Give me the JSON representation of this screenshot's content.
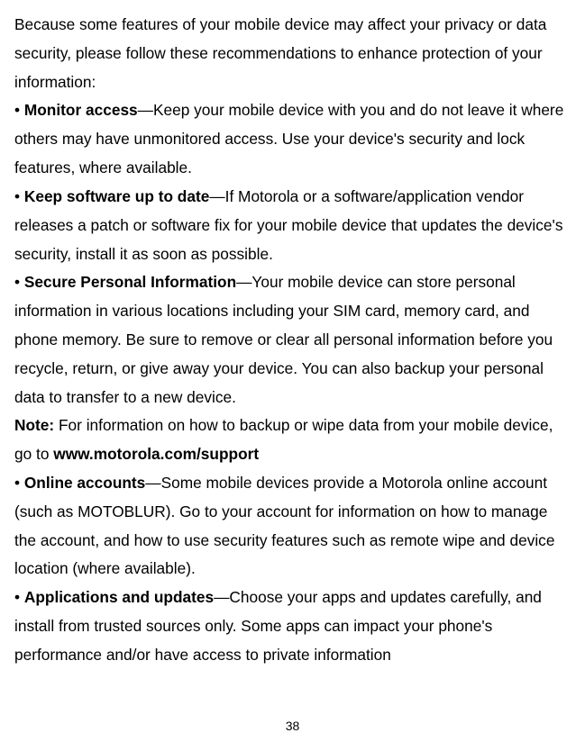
{
  "intro": "Because some features of your mobile device may affect your privacy or data security, please follow these recommendations to enhance protection of your information:",
  "items": [
    {
      "title": "Monitor access",
      "body": "—Keep your mobile device with you and do not leave it where others may have unmonitored access. Use your device's security and lock features, where available."
    },
    {
      "title": "Keep software up to date",
      "body": "—If Motorola or a software/application vendor releases a patch or software fix for your mobile device that updates the device's security, install it as soon as possible."
    },
    {
      "title": "Secure Personal Information",
      "body": "—Your mobile device can store personal information in various locations including your SIM card, memory card, and phone memory. Be sure to remove or clear all personal information before you recycle, return, or give away your device. You can also backup your personal data to transfer to a new device."
    }
  ],
  "note_label": "Note:",
  "note_body_pre": " For information on how to backup or wipe data from your mobile device, go to ",
  "note_url": "www.motorola.com/support",
  "items2": [
    {
      "title": "Online accounts",
      "body": "—Some mobile devices provide a Motorola online account (such as MOTOBLUR). Go to your account for information on how to manage the account, and how to use security features such as remote wipe and device location (where available)."
    },
    {
      "title": "Applications and updates",
      "body": "—Choose your apps and updates carefully, and install from trusted sources only. Some apps can impact your phone's performance and/or have access to private information"
    }
  ],
  "bullet": "• ",
  "page_number": "38"
}
